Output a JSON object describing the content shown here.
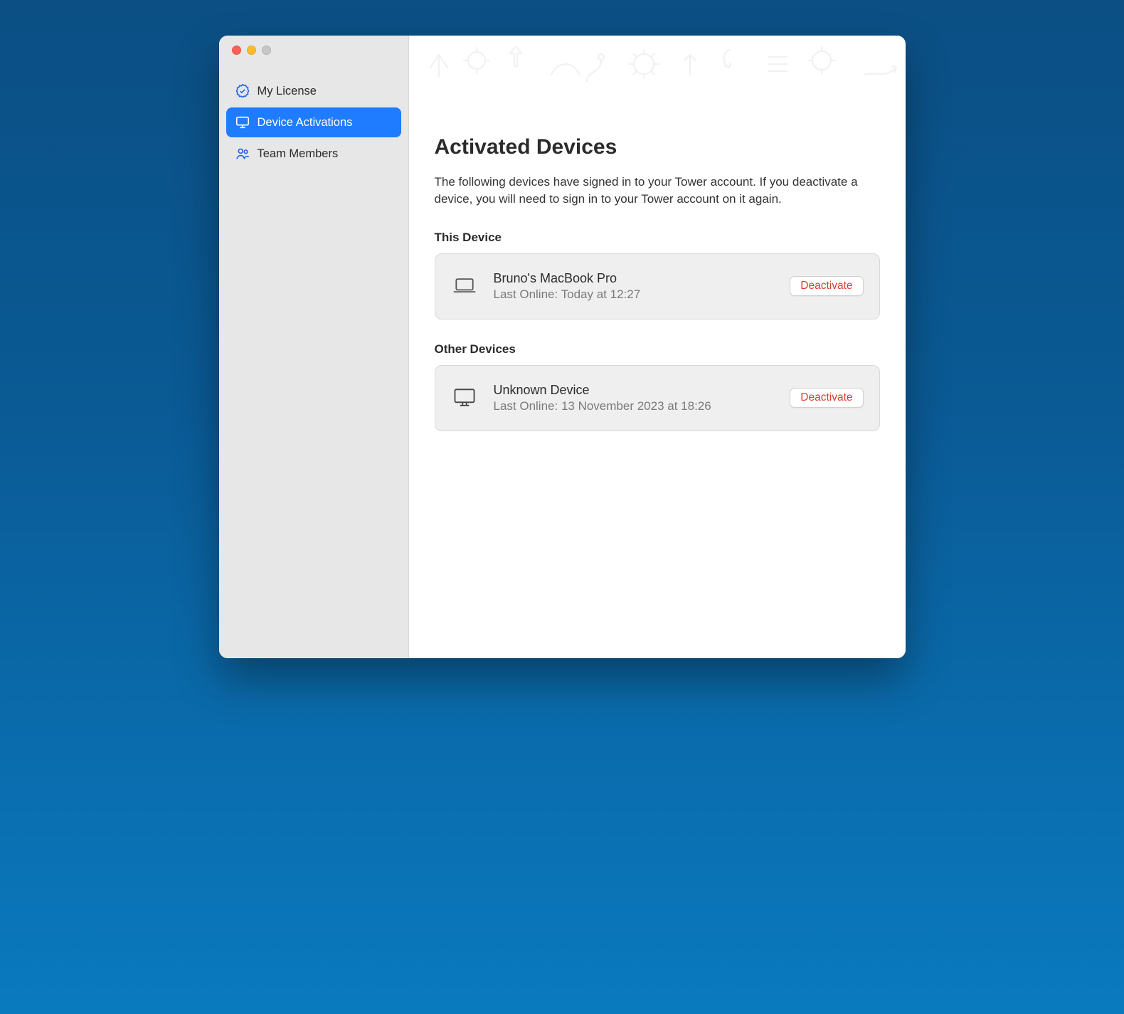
{
  "sidebar": {
    "items": [
      {
        "label": "My License",
        "icon": "badge-check-icon",
        "active": false
      },
      {
        "label": "Device Activations",
        "icon": "monitor-icon",
        "active": true
      },
      {
        "label": "Team Members",
        "icon": "users-icon",
        "active": false
      }
    ]
  },
  "page": {
    "title": "Activated Devices",
    "intro": "The following devices have signed in to your Tower account. If you deactivate a device, you will need to sign in to your Tower account on it again."
  },
  "sections": {
    "this_device": {
      "heading": "This Device",
      "device": {
        "name": "Bruno's MacBook Pro",
        "last_online": "Last Online: Today at 12:27",
        "icon": "laptop-icon",
        "deactivate_label": "Deactivate"
      }
    },
    "other_devices": {
      "heading": "Other Devices",
      "devices": [
        {
          "name": "Unknown Device",
          "last_online": "Last Online: 13 November 2023 at 18:26",
          "icon": "desktop-icon",
          "deactivate_label": "Deactivate"
        }
      ]
    }
  },
  "colors": {
    "accent": "#1f7cff",
    "danger": "#e0382e"
  }
}
